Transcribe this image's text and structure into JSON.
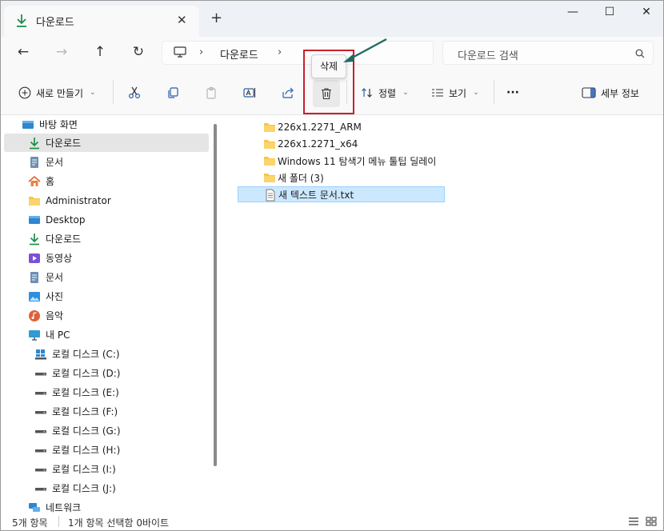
{
  "tab": {
    "title": "다운로드",
    "close": "✕",
    "new": "+"
  },
  "window_controls": {
    "minimize": "—",
    "maximize": "☐",
    "close": "✕"
  },
  "nav": {
    "back": "←",
    "forward": "→",
    "up": "↑",
    "refresh": "↻"
  },
  "address": {
    "chevron": "›",
    "crumb": "다운로드"
  },
  "search": {
    "placeholder": "다운로드 검색"
  },
  "commands": {
    "new": "새로 만들기",
    "sort": "정렬",
    "view": "보기",
    "more": "···",
    "details": "세부 정보",
    "tooltip": "삭제"
  },
  "sidebar": {
    "items": [
      {
        "label": "바탕 화면",
        "icon": "desktop-icon"
      },
      {
        "label": "다운로드",
        "icon": "download-icon",
        "selected": true
      },
      {
        "label": "문서",
        "icon": "document-icon"
      },
      {
        "label": "홈",
        "icon": "home-icon"
      },
      {
        "label": "Administrator",
        "icon": "folder-icon"
      },
      {
        "label": "Desktop",
        "icon": "desktop-icon"
      },
      {
        "label": "다운로드",
        "icon": "download-icon"
      },
      {
        "label": "동영상",
        "icon": "video-icon"
      },
      {
        "label": "문서",
        "icon": "document-icon"
      },
      {
        "label": "사진",
        "icon": "picture-icon"
      },
      {
        "label": "음악",
        "icon": "music-icon"
      },
      {
        "label": "내 PC",
        "icon": "pc-icon"
      },
      {
        "label": "로컬 디스크 (C:)",
        "icon": "windows-drive-icon"
      },
      {
        "label": "로컬 디스크 (D:)",
        "icon": "drive-icon"
      },
      {
        "label": "로컬 디스크 (E:)",
        "icon": "drive-icon"
      },
      {
        "label": "로컬 디스크 (F:)",
        "icon": "drive-icon"
      },
      {
        "label": "로컬 디스크 (G:)",
        "icon": "drive-icon"
      },
      {
        "label": "로컬 디스크 (H:)",
        "icon": "drive-icon"
      },
      {
        "label": "로컬 디스크 (I:)",
        "icon": "drive-icon"
      },
      {
        "label": "로컬 디스크 (J:)",
        "icon": "drive-icon"
      },
      {
        "label": "네트워크",
        "icon": "network-icon"
      }
    ]
  },
  "files": [
    {
      "name": "226x1.2271_ARM",
      "type": "folder"
    },
    {
      "name": "226x1.2271_x64",
      "type": "folder"
    },
    {
      "name": "Windows 11 탐색기 메뉴 툴팁 딜레이",
      "type": "folder"
    },
    {
      "name": "새 폴더 (3)",
      "type": "folder"
    },
    {
      "name": "새 텍스트 문서.txt",
      "type": "text",
      "selected": true
    }
  ],
  "status": {
    "count": "5개 항목",
    "selection": "1개 항목 선택함 0바이트"
  },
  "colors": {
    "annotation_box": "#c8202a",
    "annotation_arrow": "#1f6b63",
    "selection_bg": "#cce8ff",
    "folder": "#f7c548",
    "download_green": "#1a8f4c"
  }
}
